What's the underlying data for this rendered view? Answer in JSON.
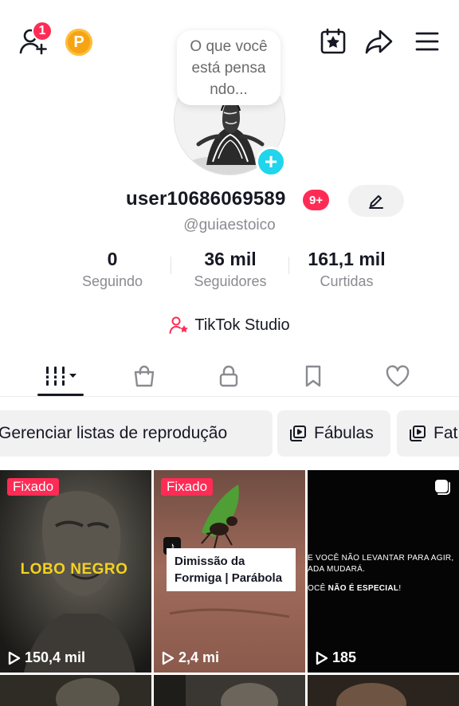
{
  "header": {
    "add_friends_badge": "1",
    "coin_label": "P",
    "thought_bubble": "O que você\nestá pensa\nndo..."
  },
  "profile": {
    "username": "user10686069589",
    "badge": "9+",
    "handle": "@guiaestoico"
  },
  "stats": [
    {
      "value": "0",
      "label": "Seguindo"
    },
    {
      "value": "36 mil",
      "label": "Seguidores"
    },
    {
      "value": "161,1 mil",
      "label": "Curtidas"
    }
  ],
  "studio_label": "TikTok Studio",
  "tabs": [
    "videos-grid-icon",
    "shop-bag-icon",
    "lock-icon",
    "bookmark-icon",
    "heart-icon"
  ],
  "playlists": {
    "manage": "Gerenciar listas de reprodução",
    "items": [
      "Fábulas",
      "Fat"
    ]
  },
  "videos": [
    {
      "pinned": "Fixado",
      "title": "LOBO NEGRO",
      "views": "150,4 mil"
    },
    {
      "pinned": "Fixado",
      "title": "Dimissão da\nFormiga | Parábola",
      "views": "2,4 mi"
    },
    {
      "line1": "E VOCÊ NÃO LEVANTAR PARA AGIR,",
      "line2": "ADA MUDARÁ.",
      "line3a": "OCÊ ",
      "line3b": "NÃO É ESPECIAL",
      "line3c": "!",
      "views": "185"
    }
  ],
  "colors": {
    "accent": "#fe2c55",
    "plus": "#20d5ec",
    "coin": "#f6a414",
    "title_yellow": "#f3d21f"
  }
}
